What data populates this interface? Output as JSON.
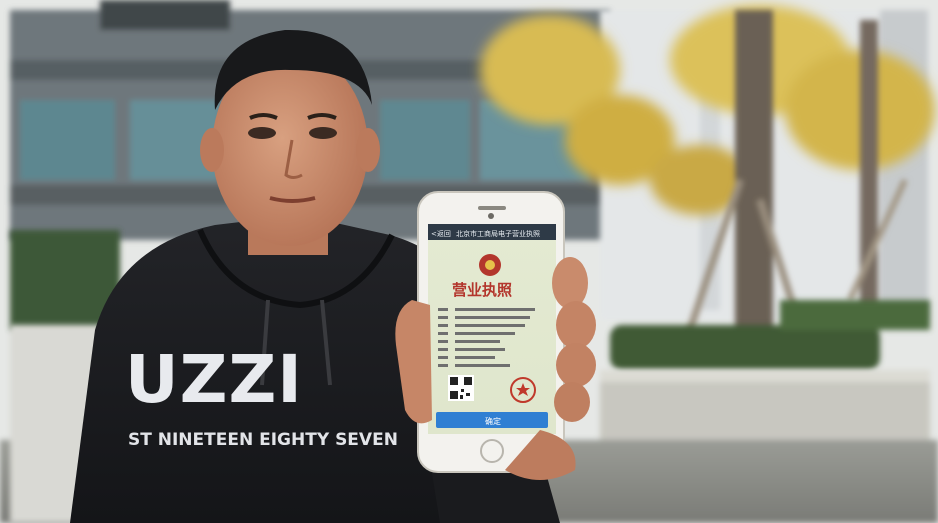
{
  "scene": {
    "description_free": true
  },
  "hoodie": {
    "brand_text": "UZZI",
    "tagline": "ST NINETEEN EIGHTY SEVEN"
  },
  "phone": {
    "screen": {
      "nav_back": "<返回",
      "nav_title": "北京市工商局电子营业执照",
      "license_title": "营业执照",
      "button_label": "确定"
    }
  },
  "colors": {
    "sky": "#e9ecef",
    "building": "#6f7a7e",
    "glass": "#5f8a92",
    "foliage_yellow": "#d9b84a",
    "hoodie": "#1c1d20",
    "skin": "#c98a6b",
    "phone_body": "#f4f3ef",
    "screen_bg": "#e8ecd8",
    "license_red": "#b3362c",
    "button_blue": "#2f7fd3"
  }
}
